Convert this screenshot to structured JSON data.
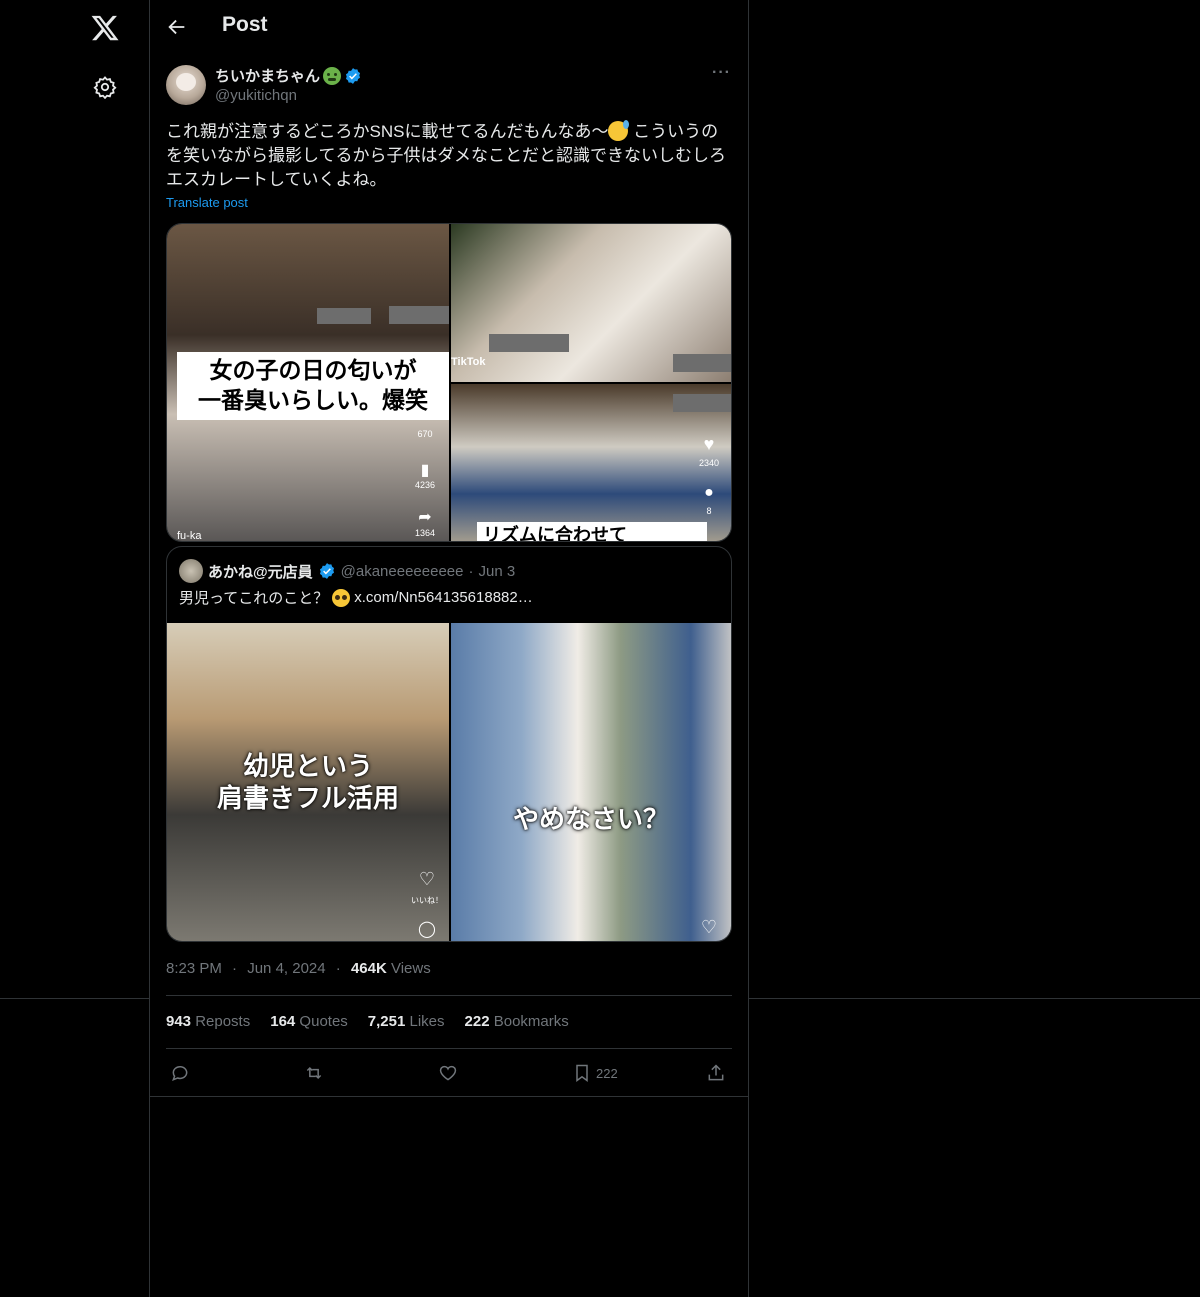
{
  "header": {
    "title": "Post"
  },
  "author": {
    "name": "ちいかまちゃん",
    "handle": "@yukitichqn"
  },
  "post": {
    "text_part1": "これ親が注意するどころかSNSに載せてるんだもんなあ〜",
    "text_part2": " こういうのを笑いながら撮影してるから子供はダメなことだと認識できないしむしろエスカレートしていくよね。",
    "translate_label": "Translate post",
    "more_label": "···"
  },
  "media": {
    "tile_a_caption_line1": "女の子の日の匂いが",
    "tile_a_caption_line2": "一番臭いらしい。爆笑",
    "tile_a_counts": [
      "670",
      "4236",
      "1364"
    ],
    "tile_a_handle": "fu-ka",
    "tile_b_tiktok": "TikTok",
    "tile_c_caption": "リズムに合わせて",
    "tile_c_counts": [
      "2340",
      "8"
    ]
  },
  "quote": {
    "name": "あかね@元店員",
    "handle": "@akaneeeeeeeee",
    "sep": "·",
    "date": "Jun 3",
    "text": "男児ってこれのこと？",
    "link": "x.com/Nn564135618882…",
    "media_a_caption_line1": "幼児という",
    "media_a_caption_line2": "肩書きフル活用",
    "media_b_caption": "やめなさい？",
    "media_a_like_label": "いいね！"
  },
  "timestamp": {
    "time": "8:23 PM",
    "sep1": "·",
    "date": "Jun 4, 2024",
    "sep2": "·",
    "views_count": "464K",
    "views_label": " Views"
  },
  "stats": {
    "reposts_count": "943",
    "reposts_label": " Reposts",
    "quotes_count": "164",
    "quotes_label": " Quotes",
    "likes_count": "7,251",
    "likes_label": " Likes",
    "bookmarks_count": "222",
    "bookmarks_label": " Bookmarks"
  },
  "actions": {
    "bookmark_count": "222"
  },
  "colors": {
    "background": "#000000",
    "text": "#e7e9ea",
    "muted": "#71767b",
    "accent": "#1d9bf0",
    "border": "#2f3336"
  },
  "icons": [
    "x-logo-icon",
    "gear-icon",
    "back-arrow-icon",
    "verified-icon",
    "more-icon",
    "reply-icon",
    "repost-icon",
    "like-icon",
    "bookmark-icon",
    "share-icon"
  ]
}
